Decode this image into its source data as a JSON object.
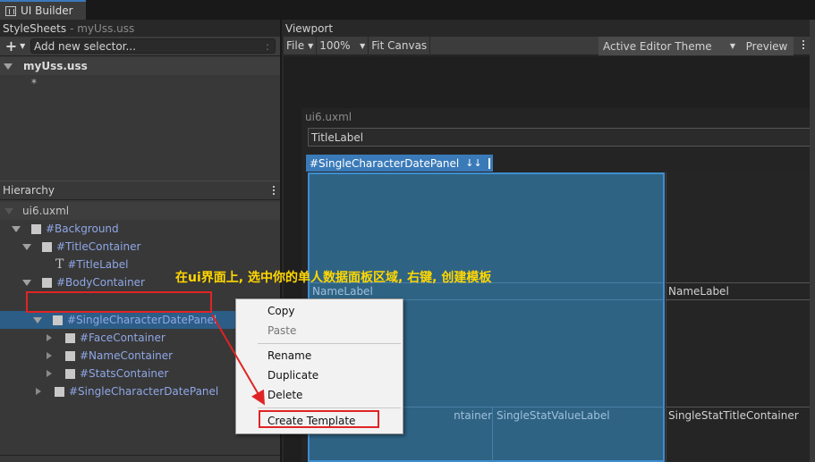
{
  "window": {
    "tab_title": "UI Builder"
  },
  "stylesheets": {
    "header": "StyleSheets",
    "header_sub": "- myUss.uss",
    "add_selector_placeholder": "Add new selector...",
    "colon": ":",
    "file": "myUss.uss",
    "selector": "*"
  },
  "hierarchy": {
    "header": "Hierarchy",
    "root": "ui6.uxml",
    "items": [
      {
        "label": "#Background"
      },
      {
        "label": "#TitleContainer"
      },
      {
        "label": "#TitleLabel",
        "icon": "T"
      },
      {
        "label": "#BodyContainer"
      },
      {
        "label": "#SingleCharacterDatePanel"
      },
      {
        "label": "#FaceContainer"
      },
      {
        "label": "#NameContainer"
      },
      {
        "label": "#StatsContainer"
      },
      {
        "label": "#SingleCharacterDatePanel"
      }
    ]
  },
  "viewport": {
    "header": "Viewport",
    "file_menu": "File",
    "zoom": "100%",
    "fit_canvas": "Fit Canvas",
    "theme": "Active Editor Theme",
    "preview": "Preview",
    "document": "ui6.uxml",
    "title_label": "TitleLabel",
    "selected_tag": "#SingleCharacterDatePanel",
    "name_label_1": "NameLabel",
    "name_label_2": "NameLabel",
    "stat_container_partial": "ntainer",
    "stat_value_label": "SingleStatValueLabel",
    "stat_title_container": "SingleStatTitleContainer"
  },
  "annotation": {
    "text": "在ui界面上, 选中你的单人数据面板区域, 右键, 创建模板",
    "color": "#ffd700",
    "highlight_color": "#e02424"
  },
  "context_menu": {
    "copy": "Copy",
    "paste": "Paste",
    "rename": "Rename",
    "duplicate": "Duplicate",
    "delete": "Delete",
    "create_template": "Create Template"
  }
}
